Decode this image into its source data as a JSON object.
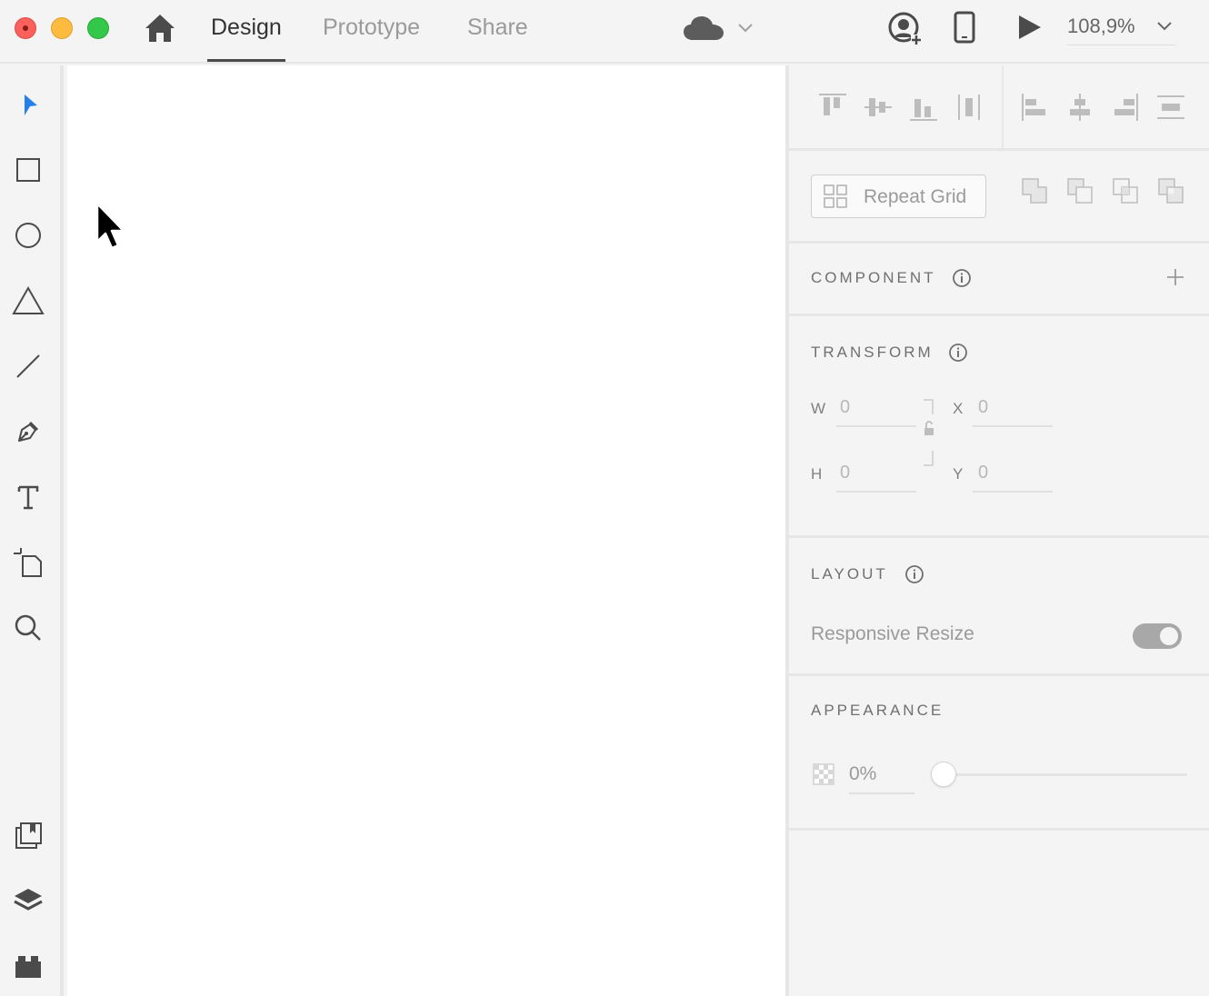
{
  "titlebar": {
    "tabs": [
      {
        "label": "Design",
        "active": true
      },
      {
        "label": "Prototype",
        "active": false
      },
      {
        "label": "Share",
        "active": false
      }
    ],
    "zoom": "108,9%"
  },
  "toolbar": {
    "tools": [
      "select-tool",
      "rectangle-tool",
      "ellipse-tool",
      "polygon-tool",
      "line-tool",
      "pen-tool",
      "text-tool",
      "artboard-tool",
      "zoom-tool"
    ],
    "bottom": [
      "assets-panel",
      "layers-panel",
      "plugins-panel"
    ]
  },
  "panel": {
    "repeat_grid_label": "Repeat Grid",
    "component": {
      "title": "COMPONENT"
    },
    "transform": {
      "title": "TRANSFORM",
      "w_label": "W",
      "w_value": "0",
      "h_label": "H",
      "h_value": "0",
      "x_label": "X",
      "x_value": "0",
      "y_label": "Y",
      "y_value": "0"
    },
    "layout": {
      "title": "LAYOUT",
      "responsive_resize_label": "Responsive Resize",
      "responsive_resize_on": true
    },
    "appearance": {
      "title": "APPEARANCE",
      "opacity_value": "0%",
      "opacity_slider": 0
    }
  },
  "colors": {
    "accent_select": "#2680eb",
    "panel_bg": "#f4f4f4",
    "canvas_bg": "#ffffff"
  }
}
